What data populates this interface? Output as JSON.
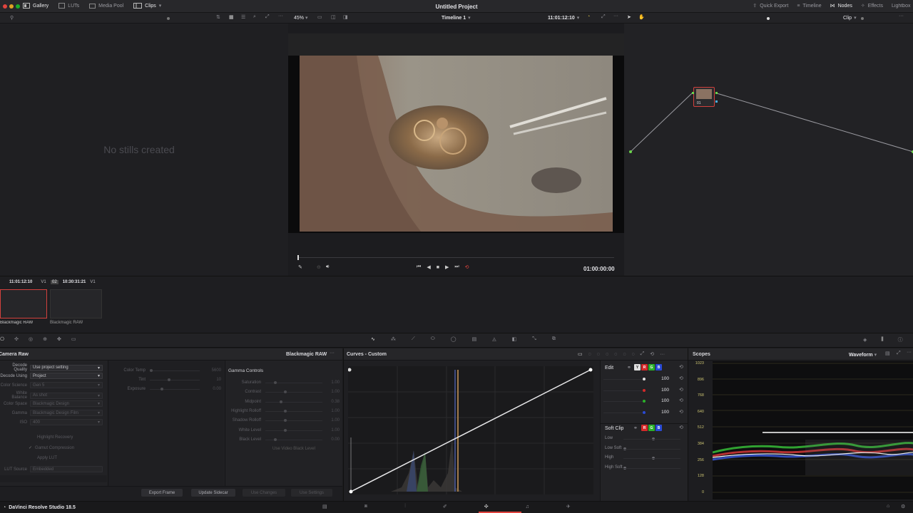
{
  "topbar": {
    "title": "Untitled Project",
    "left_items": [
      {
        "label": "Gallery",
        "icon": "gallery-icon",
        "active": true
      },
      {
        "label": "LUTs",
        "icon": "luts-icon",
        "active": false
      },
      {
        "label": "Media Pool",
        "icon": "media-pool-icon",
        "active": false
      },
      {
        "label": "Clips",
        "icon": "clips-icon",
        "active": true
      }
    ],
    "right_items": [
      {
        "label": "Quick Export",
        "icon": "export-icon",
        "active": false
      },
      {
        "label": "Timeline",
        "icon": "timeline-icon",
        "active": false
      },
      {
        "label": "Nodes",
        "icon": "nodes-icon",
        "active": true
      },
      {
        "label": "Effects",
        "icon": "effects-icon",
        "active": false
      },
      {
        "label": "Lightbox",
        "icon": "lightbox-icon",
        "active": false
      }
    ]
  },
  "viewer": {
    "zoom": "45%",
    "timeline_name": "Timeline 1",
    "timecode_top": "11:01:12:10",
    "timecode_bottom": "01:00:00:00"
  },
  "nodes": {
    "mode_label": "Clip",
    "node_label": "01"
  },
  "gallery": {
    "empty_text": "No stills created"
  },
  "clips": [
    {
      "index": "01",
      "timecode": "11:01:12:10",
      "track": "V1",
      "name": "Blackmagic RAW",
      "selected": true
    },
    {
      "index": "02",
      "timecode": "10:30:31:21",
      "track": "V1",
      "name": "Blackmagic RAW",
      "selected": false
    }
  ],
  "raw_panel": {
    "title": "Camera Raw",
    "header_right": "Blackmagic RAW",
    "fields": [
      {
        "label": "Decode Quality",
        "value": "Use project setting",
        "enabled": true
      },
      {
        "label": "Decode Using",
        "value": "Project",
        "enabled": true
      },
      {
        "label": "Color Science",
        "value": "Gen 5",
        "enabled": false
      },
      {
        "label": "White Balance",
        "value": "As shot",
        "enabled": false
      },
      {
        "label": "Color Space",
        "value": "Blackmagic Design",
        "enabled": false
      },
      {
        "label": "Gamma",
        "value": "Blackmagic Design Film",
        "enabled": false
      },
      {
        "label": "ISO",
        "value": "400",
        "enabled": false
      }
    ],
    "checkboxes": [
      "Highlight Recovery",
      "Gamut Compression",
      "Apply LUT"
    ],
    "lut_source": {
      "label": "LUT Source",
      "value": "Embedded"
    },
    "sliders_mid": [
      {
        "label": "Color Temp",
        "value": "5600"
      },
      {
        "label": "Tint",
        "value": "10"
      },
      {
        "label": "Exposure",
        "value": "0.00"
      }
    ],
    "gamma_controls_title": "Gamma Controls",
    "gamma_sliders": [
      {
        "label": "Saturation",
        "value": "1.00"
      },
      {
        "label": "Contrast",
        "value": "1.00"
      },
      {
        "label": "Midpoint",
        "value": "0.38"
      },
      {
        "label": "Highlight Rolloff",
        "value": "1.00"
      },
      {
        "label": "Shadow Rolloff",
        "value": "1.00"
      },
      {
        "label": "White Level",
        "value": "1.00"
      },
      {
        "label": "Black Level",
        "value": "0.00"
      }
    ],
    "video_black_level": "Use Video Black Level",
    "buttons": [
      "Export Frame",
      "Update Sidecar",
      "Use Changes",
      "Use Settings"
    ]
  },
  "curves": {
    "title": "Curves - Custom",
    "edit_label": "Edit",
    "channel_values": [
      "100",
      "100",
      "100",
      "100"
    ],
    "soft_clip_label": "Soft Clip",
    "soft_clip_rows": [
      "Low",
      "Low Soft",
      "High",
      "High Soft"
    ],
    "colors": {
      "red": "#d42a2a",
      "green": "#2ab02a",
      "blue": "#2a4ad4",
      "y": "#e0e0e0"
    }
  },
  "scopes": {
    "title": "Scopes",
    "mode": "Waveform",
    "ticks": [
      "1023",
      "896",
      "768",
      "640",
      "512",
      "384",
      "256",
      "128",
      "0"
    ]
  },
  "status": {
    "app_name": "DaVinci Resolve Studio 18.5"
  }
}
